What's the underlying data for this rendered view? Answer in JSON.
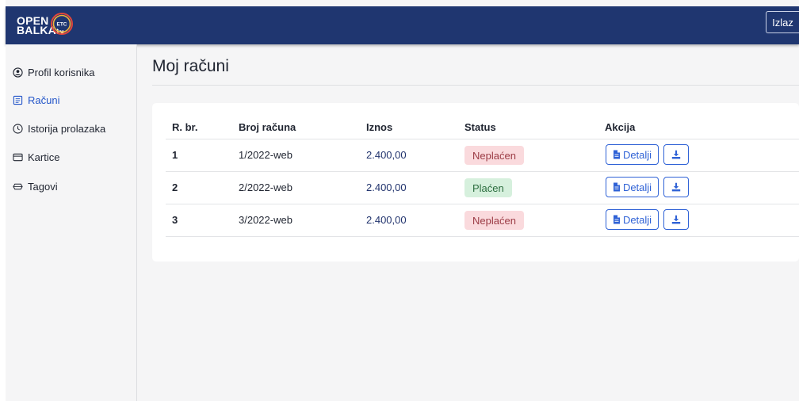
{
  "header": {
    "logo_line1": "OPEN",
    "logo_line2": "BALKAN",
    "logo_badge": "ETC",
    "logout_label": "Izlaz"
  },
  "sidebar": {
    "items": [
      {
        "label": "Profil korisnika",
        "icon": "user-circle-icon",
        "active": false
      },
      {
        "label": "Računi",
        "icon": "receipt-icon",
        "active": true
      },
      {
        "label": "Istorija prolazaka",
        "icon": "clock-icon",
        "active": false
      },
      {
        "label": "Kartice",
        "icon": "credit-card-icon",
        "active": false
      },
      {
        "label": "Tagovi",
        "icon": "tag-icon",
        "active": false
      }
    ]
  },
  "main": {
    "title": "Moj računi",
    "table": {
      "columns": [
        "R. br.",
        "Broj računa",
        "Iznos",
        "Status",
        "Akcija"
      ],
      "rows": [
        {
          "num": "1",
          "invoice": "1/2022-web",
          "amount": "2.400,00",
          "status": "Neplaćen",
          "detail_label": "Detalji"
        },
        {
          "num": "2",
          "invoice": "2/2022-web",
          "amount": "2.400,00",
          "status": "Plaćen",
          "detail_label": "Detalji"
        },
        {
          "num": "3",
          "invoice": "3/2022-web",
          "amount": "2.400,00",
          "status": "Neplaćen",
          "detail_label": "Detalji"
        }
      ]
    }
  },
  "colors": {
    "navbar": "#1f3670",
    "accent": "#2f62d6",
    "unpaid_bg": "#fadadd",
    "paid_bg": "#d6f0dd"
  }
}
